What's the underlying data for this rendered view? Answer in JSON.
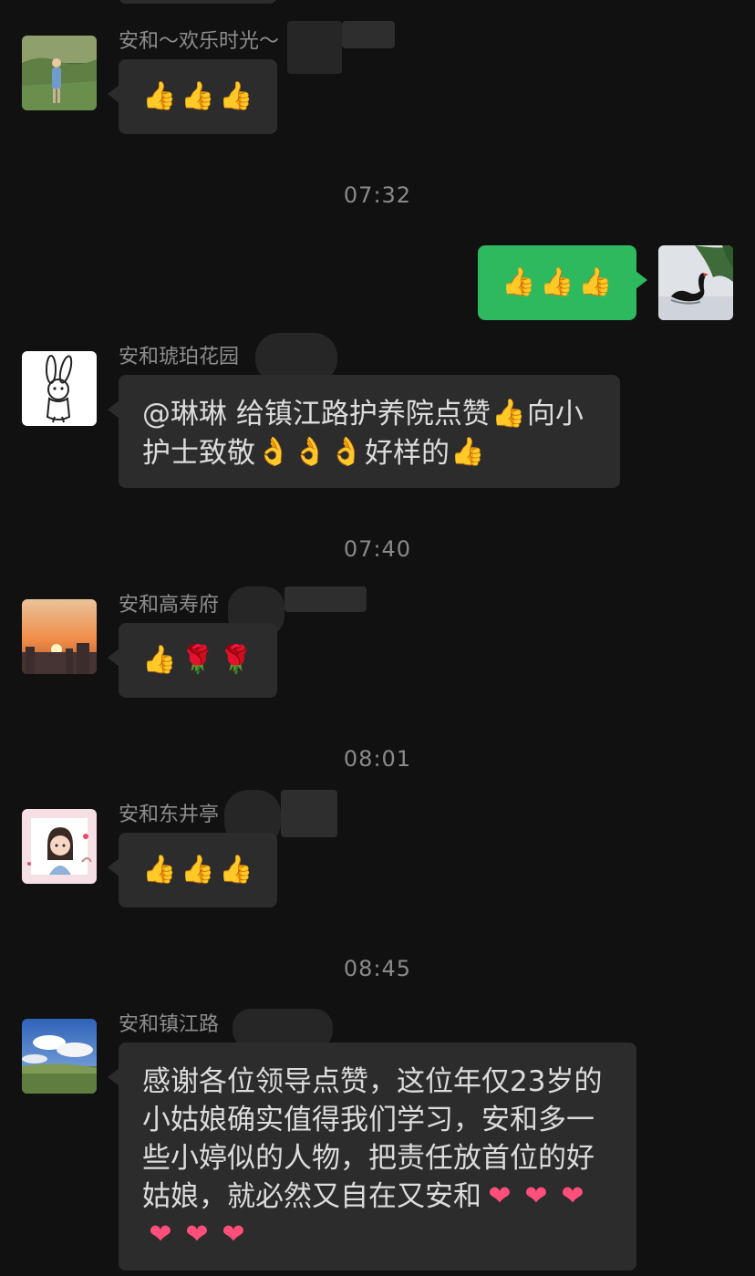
{
  "messages": [
    {
      "sender": "安和～欢乐时光～",
      "avatar": "avatar-child-in-field",
      "content_type": "emoji",
      "emojis": [
        "thumbs-up",
        "thumbs-up",
        "thumbs-up"
      ]
    },
    {
      "time": "07:32"
    },
    {
      "sender": "self",
      "avatar": "avatar-black-swan",
      "content_type": "emoji",
      "emojis": [
        "thumbs-up",
        "thumbs-up",
        "thumbs-up"
      ]
    },
    {
      "sender": "安和琥珀花园",
      "avatar": "avatar-rabbit-sketch",
      "content_type": "text",
      "text": "@琳琳 给镇江路护养院点赞👍向小护士致敬👌👌👌好样的👍"
    },
    {
      "time": "07:40"
    },
    {
      "sender": "安和高寿府",
      "avatar": "avatar-sunset",
      "content_type": "emoji",
      "emojis": [
        "thumbs-up",
        "rose",
        "rose"
      ]
    },
    {
      "time": "08:01"
    },
    {
      "sender": "安和东井亭",
      "avatar": "avatar-cartoon-girl",
      "content_type": "emoji",
      "emojis": [
        "thumbs-up",
        "thumbs-up",
        "thumbs-up"
      ]
    },
    {
      "time": "08:45"
    },
    {
      "sender": "安和镇江路",
      "avatar": "avatar-landscape",
      "content_type": "text",
      "text": "感谢各位领导点赞，这位年仅23岁的小姑娘确实值得我们学习，安和多一些小婷似的人物，把责任放首位的好姑娘，就必然又自在又安和❤️❤️❤️❤️❤️❤️"
    }
  ],
  "glyphs": {
    "thumbs-up": "👍",
    "rose": "🌹",
    "ok-hand": "👌",
    "heart": "❤"
  },
  "text_parts": {
    "m4_line": [
      {
        "t": "text",
        "v": "@琳琳 给镇江路护养院点赞"
      },
      {
        "t": "emoji",
        "v": "👍",
        "name": "thumbs-up"
      },
      {
        "t": "text",
        "v": "向小护士致敬"
      },
      {
        "t": "emoji",
        "v": "👌",
        "name": "ok-hand"
      },
      {
        "t": "emoji",
        "v": "👌",
        "name": "ok-hand"
      },
      {
        "t": "emoji",
        "v": "👌",
        "name": "ok-hand"
      },
      {
        "t": "text",
        "v": "好样的"
      },
      {
        "t": "emoji",
        "v": "👍",
        "name": "thumbs-up"
      }
    ],
    "m10_line": [
      {
        "t": "text",
        "v": "感谢各位领导点赞，这位年仅23岁的小姑娘确实值得我们学习，安和多一些小婷似的人物，把责任放首位的好姑娘，就必然又自在又安和"
      },
      {
        "t": "emoji",
        "v": "❤",
        "name": "heart"
      },
      {
        "t": "emoji",
        "v": "❤",
        "name": "heart"
      },
      {
        "t": "emoji",
        "v": "❤",
        "name": "heart"
      },
      {
        "t": "emoji",
        "v": "❤",
        "name": "heart"
      },
      {
        "t": "emoji",
        "v": "❤",
        "name": "heart"
      },
      {
        "t": "emoji",
        "v": "❤",
        "name": "heart"
      }
    ]
  },
  "colors": {
    "background": "#111111",
    "bubble_incoming": "#2c2c2c",
    "bubble_outgoing": "#2fb95f",
    "sender_name": "#8d8d8d",
    "timestamp": "#8a8a8a"
  }
}
